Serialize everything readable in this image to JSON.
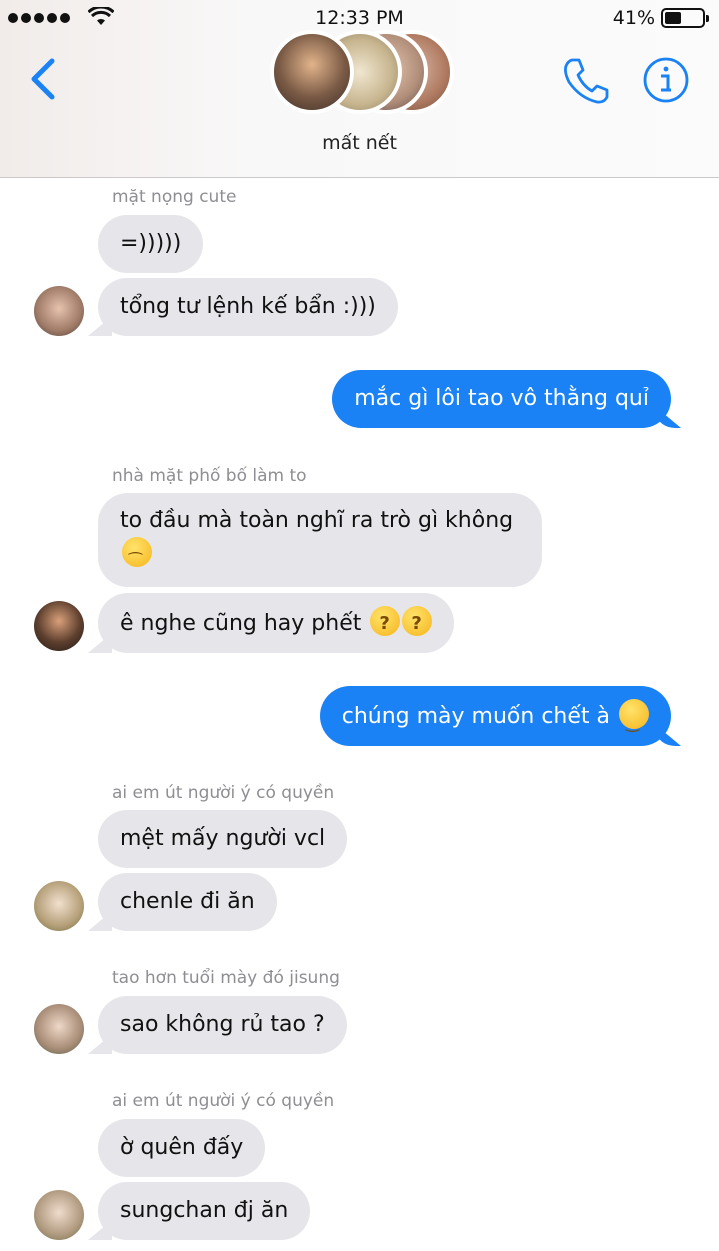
{
  "status_bar": {
    "time": "12:33 PM",
    "battery": "41%"
  },
  "header": {
    "group_name": "mất nết"
  },
  "messages": [
    {
      "sender": "mặt nọng cute"
    },
    {
      "text": "=)))))"
    },
    {
      "text": "tổng tư lệnh kế bẩn :)))"
    },
    {
      "text": "mắc gì lôi tao vô thằng quỉ"
    },
    {
      "sender": "nhà mặt phố bố làm to"
    },
    {
      "text": "to đầu mà toàn nghĩ ra trò gì không"
    },
    {
      "text": "ê nghe cũng hay phết"
    },
    {
      "text": "chúng mày muốn chết à"
    },
    {
      "sender": "ai em út người ý có quyền"
    },
    {
      "text": "mệt mấy người vcl"
    },
    {
      "text": "chenle đi ăn"
    },
    {
      "sender": "tao hơn tuổi mày đó jisung"
    },
    {
      "text": "sao không rủ tao ?"
    },
    {
      "sender": "ai em út người ý có quyền"
    },
    {
      "text": "ờ quên đấy"
    },
    {
      "text": "sungchan đj ăn"
    }
  ],
  "colors": {
    "accent": "#1a82f5",
    "incoming_bubble": "#e6e6ea",
    "sender_label": "#8e8e93"
  },
  "icons": [
    "back-chevron-icon",
    "phone-icon",
    "info-icon",
    "wifi-icon",
    "battery-icon"
  ]
}
